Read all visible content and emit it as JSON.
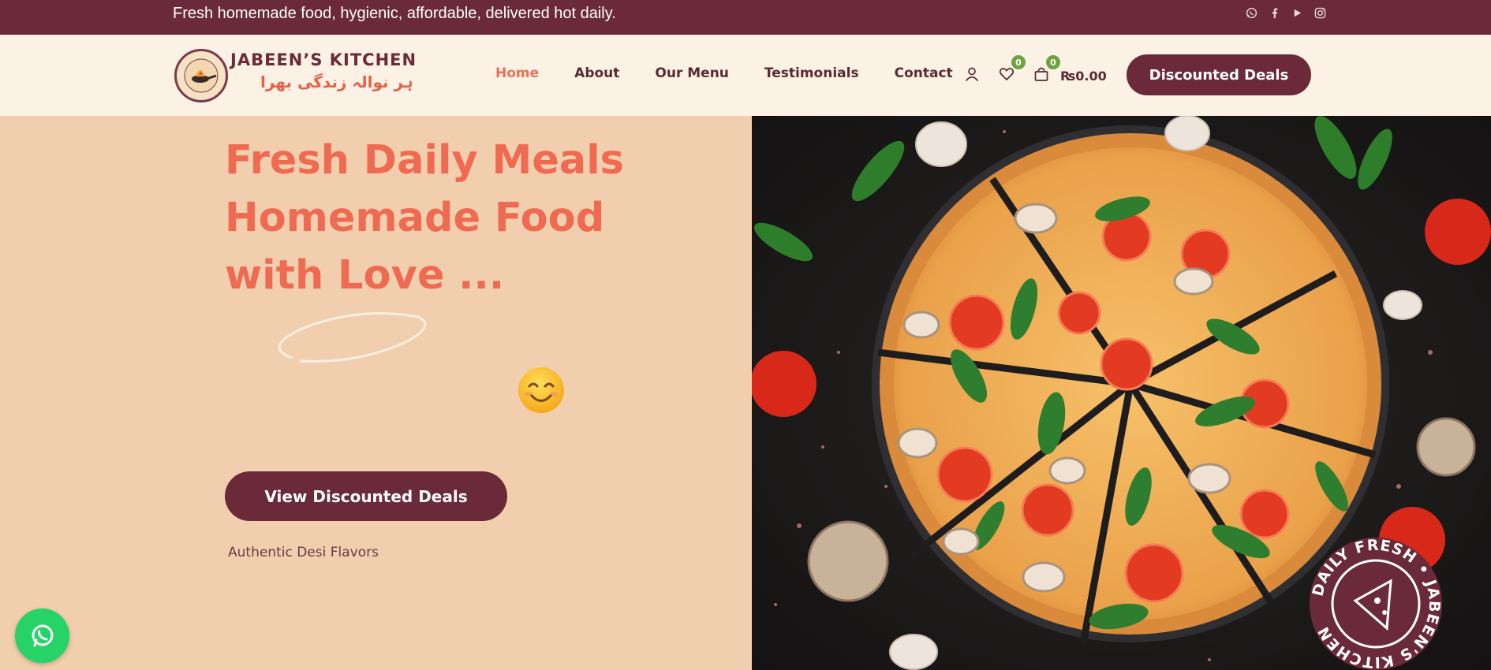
{
  "topbar": {
    "tagline": "Fresh homemade food, hygienic, affordable, delivered hot daily.",
    "socials": [
      "whatsapp-icon",
      "facebook-icon",
      "youtube-icon",
      "instagram-icon"
    ]
  },
  "header": {
    "logo_title": "JABEEN’S KITCHEN",
    "logo_urdu": "ہر نوالہ زندگی بھرا",
    "nav": [
      "Home",
      "About",
      "Our Menu",
      "Testimonials",
      "Contact"
    ],
    "active_nav": "Home",
    "wishlist_count": "0",
    "cart_count": "0",
    "cart_total": "₨0.00",
    "deals_button": "Discounted Deals"
  },
  "hero": {
    "line1": "Fresh Daily Meals",
    "line2": "Homemade Food",
    "line3": "with Love ...",
    "button": "View Discounted Deals",
    "subtitle": "Authentic Desi Flavors",
    "stamp_text": "DAILY FRESH • JABEEN'S KITCHEN"
  },
  "colors": {
    "maroon": "#6b2a3a",
    "coral": "#ee6b52",
    "hero_bg": "#f1cfae",
    "header_bg": "#fbf1e4",
    "badge_green": "#6fa240",
    "whatsapp_green": "#25d366"
  }
}
